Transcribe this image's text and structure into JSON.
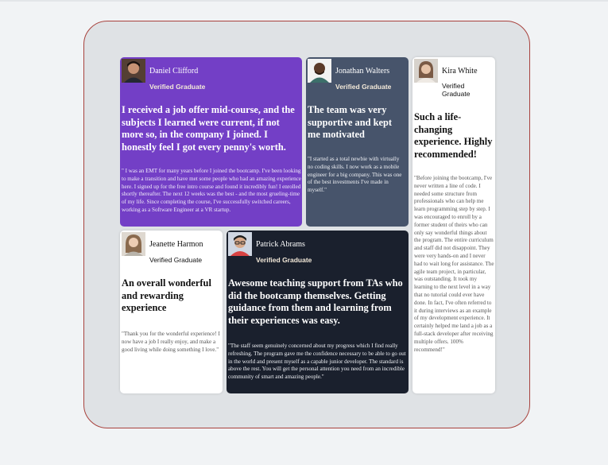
{
  "testimonials": [
    {
      "name": "Daniel Clifford",
      "badge": "Verified Graduate",
      "headline": "I received a job offer mid-course, and the subjects I learned were current, if not more so, in the company I joined. I honestly feel I got every penny's worth.",
      "quote": "\" I was an EMT for many years before I joined the bootcamp. I've been looking to make a transition and have met some people who had an amazing experience here. I signed up for the free intro course and found it incredibly fun! I enrolled shortly thereafter. The next 12 weeks was the best - and the most grueling-time of my life. Since completing the course, I've successfully switched careers, working as a Software Engineer at a VR startup.",
      "bg": "#733fc6"
    },
    {
      "name": "Jonathan Walters",
      "badge": "Verified Graduate",
      "headline": "The team was very supportive and kept me motivated",
      "quote": "\"I started as a total newbie with virtually no coding skills. I now work as a mobile engineer for a big company. This was one of the best investments I've made in myself.\"",
      "bg": "#47546b"
    },
    {
      "name": "Kira White",
      "badge": "Verified Graduate",
      "headline": "Such a life-changing experience. Highly recommended!",
      "quote": "\"Before joining the bootcamp, I've never written a line of code. I needed some structure from professionals who can help me learn programming step by step. I was encouraged to enroll by a former student of theirs who can only say wonderful things about the program. The entire curriculum and staff did not disappoint. They were very hands-on and I never had to wait long for assistance. The agile team project, in particular, was outstanding. It took my learning to the next level in a way that no tutorial could ever have done. In fact, I've often referred to it during interviews as an example of my development experience. It certainly helped me land a job as a full-stack developer after receiving multiple offers. 100% recommend!\"",
      "bg": "#ffffff"
    },
    {
      "name": "Jeanette Harmon",
      "badge": "Verified Graduate",
      "headline": "An overall wonderful and rewarding experience",
      "quote": "\"Thank you for the wonderful experience! I now have a job I really enjoy, and make a good living while doing something I love.\"",
      "bg": "#ffffff"
    },
    {
      "name": "Patrick Abrams",
      "badge": "Verified Graduate",
      "headline": "Awesome teaching support from TAs who did the bootcamp themselves. Getting guidance from them and learning from their experiences was easy.",
      "quote": "\"The staff seem genuinely concerned about my progress which I find really refreshing. The program gave me the confidence necessary to be able to go out in the world and present myself as a capable junior developer. The standard is above the rest. You will get the personal attention you need from an incredible community of smart and amazing people.\"",
      "bg": "#1a202d"
    }
  ]
}
